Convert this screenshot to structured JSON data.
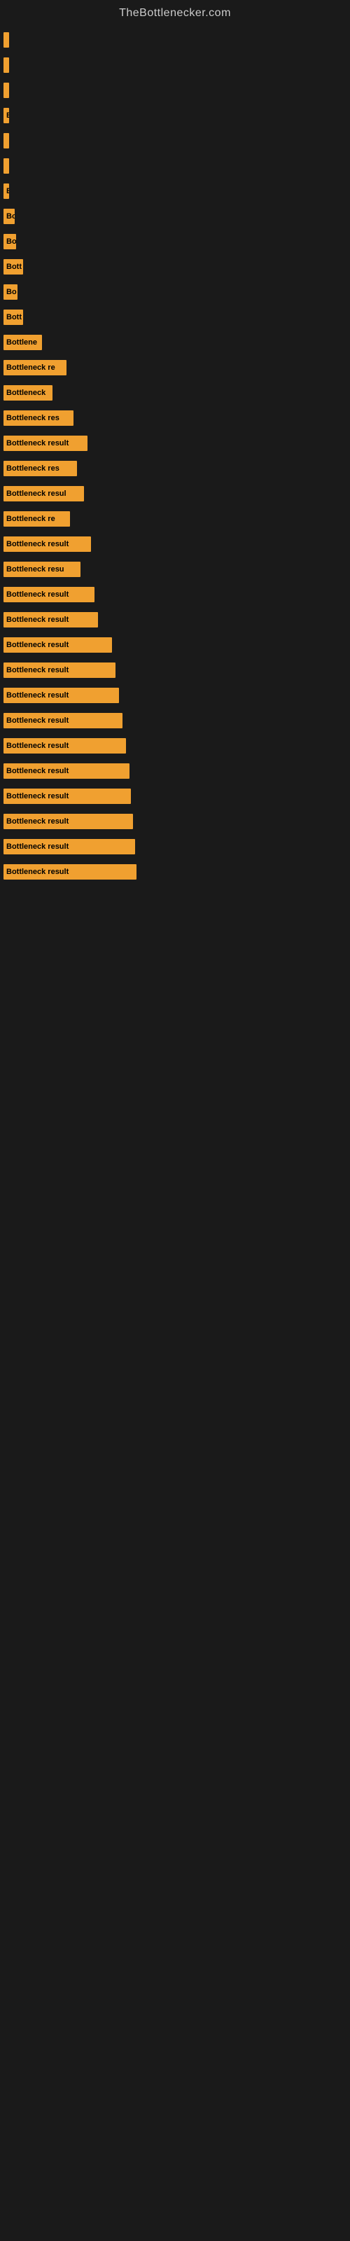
{
  "site": {
    "title": "TheBottlenecker.com"
  },
  "bars": [
    {
      "id": 1,
      "label": "",
      "width": 2
    },
    {
      "id": 2,
      "label": "",
      "width": 4
    },
    {
      "id": 3,
      "label": "",
      "width": 4
    },
    {
      "id": 4,
      "label": "B",
      "width": 8
    },
    {
      "id": 5,
      "label": "",
      "width": 4
    },
    {
      "id": 6,
      "label": "",
      "width": 4
    },
    {
      "id": 7,
      "label": "B",
      "width": 8
    },
    {
      "id": 8,
      "label": "Bo",
      "width": 16
    },
    {
      "id": 9,
      "label": "Bo",
      "width": 18
    },
    {
      "id": 10,
      "label": "Bott",
      "width": 28
    },
    {
      "id": 11,
      "label": "Bo",
      "width": 20
    },
    {
      "id": 12,
      "label": "Bott",
      "width": 28
    },
    {
      "id": 13,
      "label": "Bottlene",
      "width": 55
    },
    {
      "id": 14,
      "label": "Bottleneck re",
      "width": 90
    },
    {
      "id": 15,
      "label": "Bottleneck",
      "width": 70
    },
    {
      "id": 16,
      "label": "Bottleneck res",
      "width": 100
    },
    {
      "id": 17,
      "label": "Bottleneck result",
      "width": 120
    },
    {
      "id": 18,
      "label": "Bottleneck res",
      "width": 105
    },
    {
      "id": 19,
      "label": "Bottleneck resul",
      "width": 115
    },
    {
      "id": 20,
      "label": "Bottleneck re",
      "width": 95
    },
    {
      "id": 21,
      "label": "Bottleneck result",
      "width": 125
    },
    {
      "id": 22,
      "label": "Bottleneck resu",
      "width": 110
    },
    {
      "id": 23,
      "label": "Bottleneck result",
      "width": 130
    },
    {
      "id": 24,
      "label": "Bottleneck result",
      "width": 135
    },
    {
      "id": 25,
      "label": "Bottleneck result",
      "width": 155
    },
    {
      "id": 26,
      "label": "Bottleneck result",
      "width": 160
    },
    {
      "id": 27,
      "label": "Bottleneck result",
      "width": 165
    },
    {
      "id": 28,
      "label": "Bottleneck result",
      "width": 170
    },
    {
      "id": 29,
      "label": "Bottleneck result",
      "width": 175
    },
    {
      "id": 30,
      "label": "Bottleneck result",
      "width": 180
    },
    {
      "id": 31,
      "label": "Bottleneck result",
      "width": 182
    },
    {
      "id": 32,
      "label": "Bottleneck result",
      "width": 185
    },
    {
      "id": 33,
      "label": "Bottleneck result",
      "width": 188
    },
    {
      "id": 34,
      "label": "Bottleneck result",
      "width": 190
    }
  ]
}
